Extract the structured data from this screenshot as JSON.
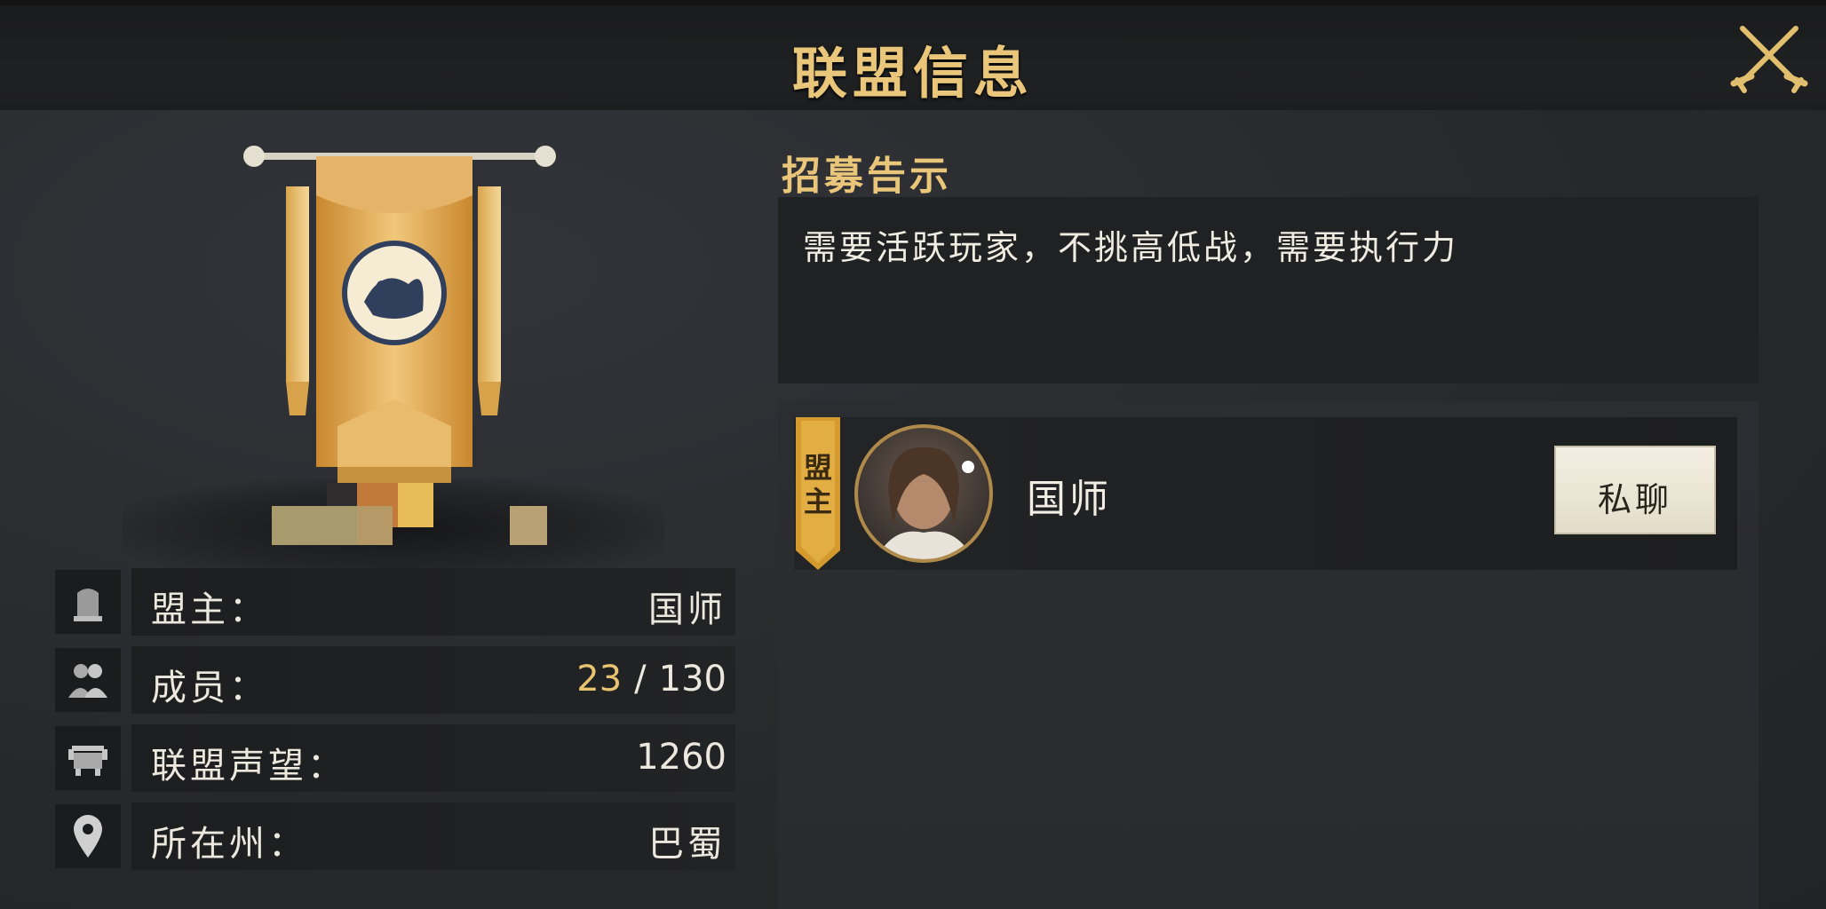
{
  "header": {
    "title": "联盟信息"
  },
  "alliance_info": {
    "rows": [
      {
        "icon": "tombstone-icon",
        "label": "盟主：",
        "value": "国师"
      },
      {
        "icon": "members-icon",
        "label": "成员：",
        "current": "23",
        "separator": "/",
        "max": "130"
      },
      {
        "icon": "cauldron-icon",
        "label": "联盟声望：",
        "value": "1260"
      },
      {
        "icon": "location-pin-icon",
        "label": "所在州：",
        "value": "巴蜀"
      }
    ]
  },
  "recruit": {
    "heading": "招募告示",
    "text": "需要活跃玩家，不挑高低战，需要执行力"
  },
  "members": [
    {
      "role_badge": "盟主",
      "name": "国师",
      "action_label": "私聊"
    }
  ],
  "colors": {
    "accent_gold": "#e9c67a",
    "panel_dark": "#202123",
    "background": "#27292b"
  }
}
